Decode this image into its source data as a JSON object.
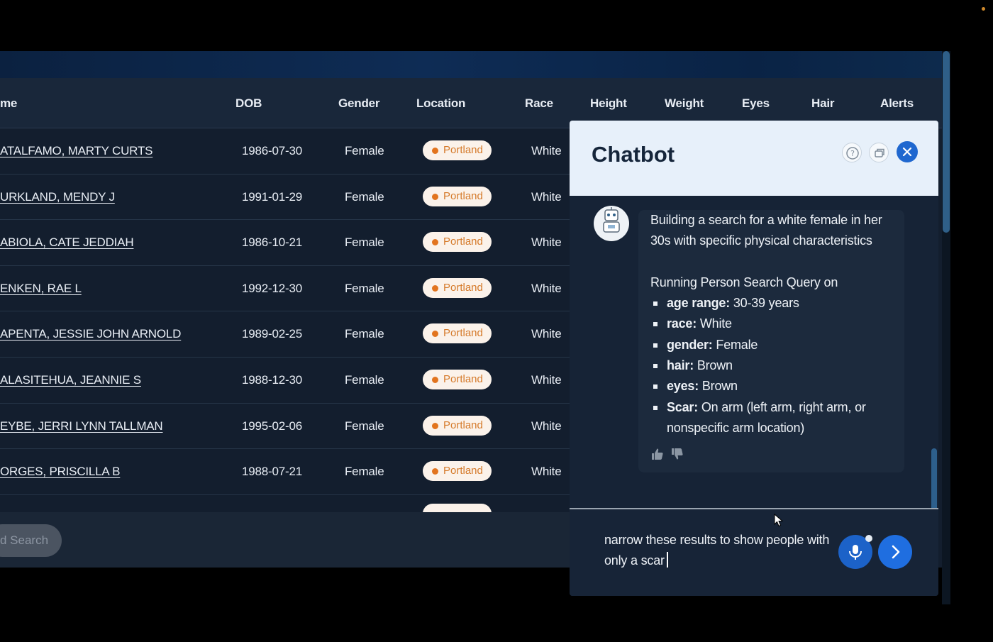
{
  "table": {
    "columns": [
      "me",
      "DOB",
      "Gender",
      "Location",
      "Race",
      "Height",
      "Weight",
      "Eyes",
      "Hair",
      "Alerts"
    ],
    "rows": [
      {
        "name": "ATALFAMO, MARTY CURTS",
        "dob": "1986-07-30",
        "gender": "Female",
        "location": "Portland",
        "race": "White"
      },
      {
        "name": "URKLAND, MENDY J",
        "dob": "1991-01-29",
        "gender": "Female",
        "location": "Portland",
        "race": "White"
      },
      {
        "name": "ABIOLA, CATE JEDDIAH",
        "dob": "1986-10-21",
        "gender": "Female",
        "location": "Portland",
        "race": "White"
      },
      {
        "name": "ENKEN, RAE L",
        "dob": "1992-12-30",
        "gender": "Female",
        "location": "Portland",
        "race": "White"
      },
      {
        "name": "APENTA, JESSIE JOHN ARNOLD",
        "dob": "1989-02-25",
        "gender": "Female",
        "location": "Portland",
        "race": "White"
      },
      {
        "name": "ALASITEHUA, JEANNIE S",
        "dob": "1988-12-30",
        "gender": "Female",
        "location": "Portland",
        "race": "White"
      },
      {
        "name": "EYBE, JERRI LYNN TALLMAN",
        "dob": "1995-02-06",
        "gender": "Female",
        "location": "Portland",
        "race": "White"
      },
      {
        "name": "ORGES, PRISCILLA B",
        "dob": "1988-07-21",
        "gender": "Female",
        "location": "Portland",
        "race": "White"
      }
    ]
  },
  "footer": {
    "search_label": "d Search"
  },
  "chatbot": {
    "title": "Chatbot",
    "message": {
      "intro": "Building a search for a white female in her 30s with specific physical characteristics",
      "query_heading": "Running Person Search Query on",
      "criteria": [
        {
          "key": "age range:",
          "value": " 30-39 years"
        },
        {
          "key": "race:",
          "value": " White"
        },
        {
          "key": "gender:",
          "value": " Female"
        },
        {
          "key": "hair:",
          "value": " Brown"
        },
        {
          "key": "eyes:",
          "value": " Brown"
        },
        {
          "key": "Scar:",
          "value": " On arm (left arm, right arm, or nonspecific arm location)"
        }
      ]
    },
    "input_value": "narrow these results to show people with only a scar"
  },
  "icons": {
    "help": "question-circle-icon",
    "copy": "copy-icon",
    "close": "close-icon",
    "avatar": "robot-icon",
    "thumbs_up": "thumbs-up-icon",
    "thumbs_down": "thumbs-down-icon",
    "mic": "microphone-icon",
    "send": "chevron-right-icon"
  },
  "colors": {
    "accent": "#1f67cf",
    "badge_text": "#d57a2a",
    "badge_dot": "#e2741e",
    "panel_header": "#e7f0fa"
  }
}
